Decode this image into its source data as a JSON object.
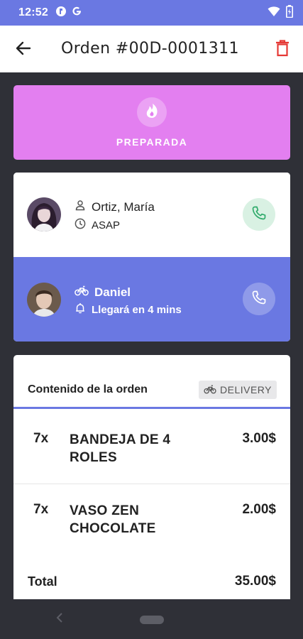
{
  "status_bar": {
    "time": "12:52",
    "icons_left": [
      "notification-app-icon",
      "google-g-icon"
    ],
    "icons_right": [
      "wifi-icon",
      "battery-icon"
    ]
  },
  "app_bar": {
    "title": "Orden #00D-0001311",
    "back_icon": "arrow-left-icon",
    "delete_icon": "trash-icon"
  },
  "order_status": {
    "label": "PREPARADA",
    "icon": "flame-icon",
    "color": "#e37ff0"
  },
  "customer": {
    "name": "Ortiz, María",
    "time": "ASAP",
    "name_icon": "person-icon",
    "time_icon": "clock-icon",
    "call_icon": "phone-icon"
  },
  "driver": {
    "name": "Daniel",
    "eta": "Llegará en 4 mins",
    "name_icon": "bicycle-icon",
    "eta_icon": "bell-icon",
    "call_icon": "phone-icon",
    "color": "#6a78e2"
  },
  "order": {
    "title": "Contenido de la orden",
    "delivery_label": "DELIVERY",
    "items": [
      {
        "qty": "7x",
        "name": "BANDEJA DE 4 ROLES",
        "price": "3.00$"
      },
      {
        "qty": "7x",
        "name": "VASO ZEN CHOCOLATE",
        "price": "2.00$"
      }
    ],
    "total_label": "Total",
    "total_value": "35.00$"
  },
  "colors": {
    "accent": "#6a78e2",
    "status_pink": "#e37ff0",
    "delete_red": "#e53935",
    "call_green": "#2eaa6a"
  }
}
